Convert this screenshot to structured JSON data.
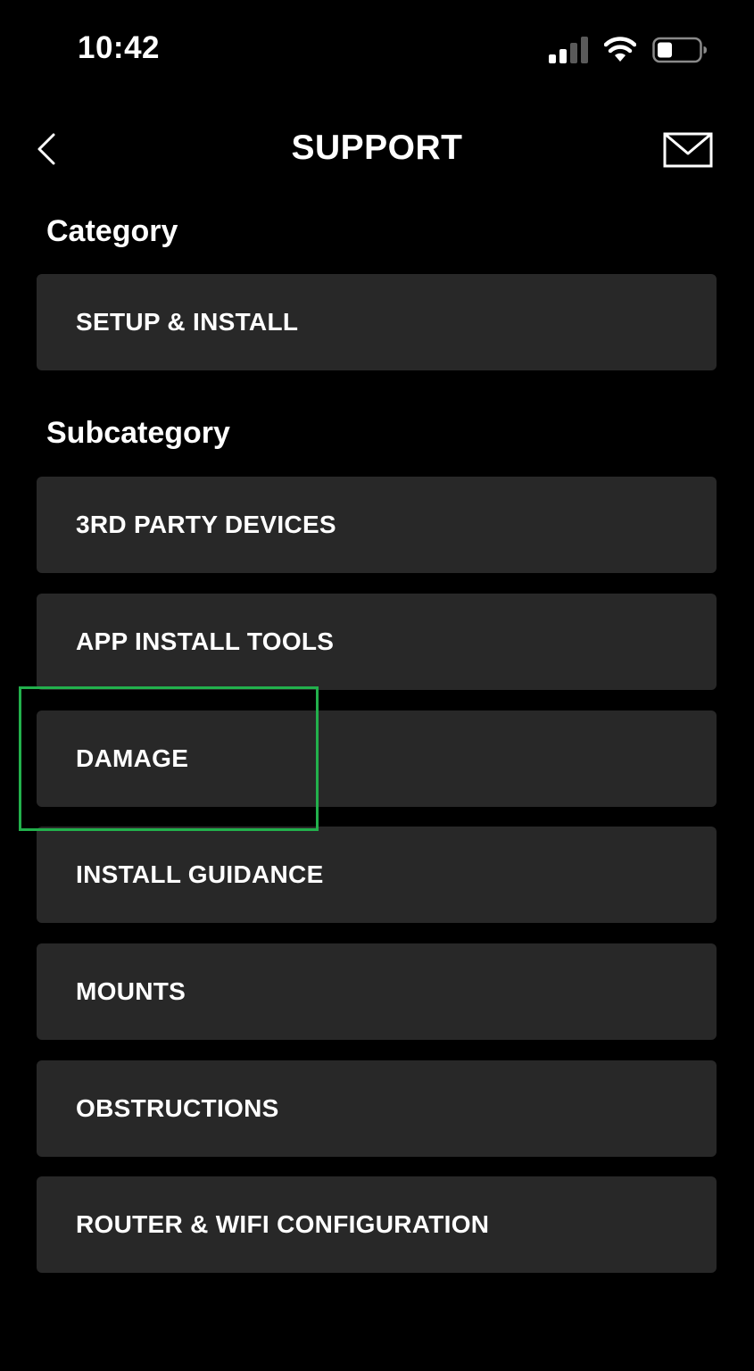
{
  "status_bar": {
    "time": "10:42"
  },
  "nav": {
    "title": "SUPPORT",
    "back_icon": "chevron-left-icon",
    "mail_icon": "mail-icon"
  },
  "category": {
    "label": "Category",
    "selected": "SETUP & INSTALL"
  },
  "subcategory": {
    "label": "Subcategory",
    "items": [
      "3RD PARTY DEVICES",
      "APP INSTALL TOOLS",
      "DAMAGE",
      "INSTALL GUIDANCE",
      "MOUNTS",
      "OBSTRUCTIONS",
      "ROUTER & WIFI CONFIGURATION"
    ]
  },
  "colors": {
    "background": "#000000",
    "item_background": "#282828",
    "text": "#ffffff",
    "highlight": "#22b04c"
  }
}
